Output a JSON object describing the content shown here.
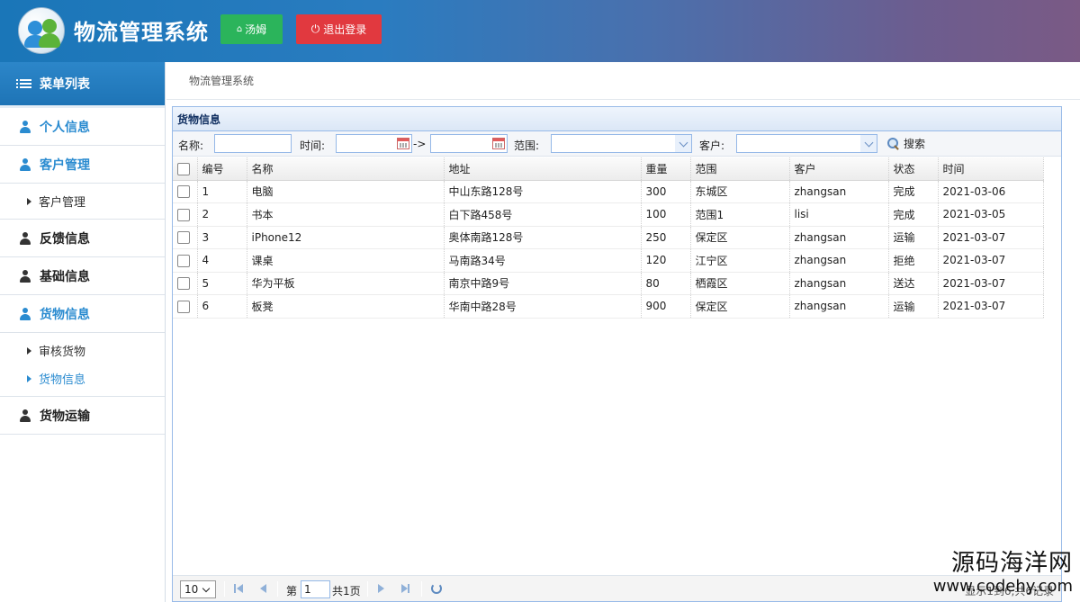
{
  "header": {
    "app_title": "物流管理系统",
    "user_button": "汤姆",
    "logout_button": "退出登录"
  },
  "sidebar": {
    "menu_title": "菜单列表",
    "items": {
      "personal": "个人信息",
      "customer": "客户管理",
      "customer_sub": "客户管理",
      "feedback": "反馈信息",
      "basic": "基础信息",
      "goods": "货物信息",
      "goods_sub_review": "审核货物",
      "goods_sub_info": "货物信息",
      "transport": "货物运输"
    }
  },
  "breadcrumb": "物流管理系统",
  "panel": {
    "title": "货物信息",
    "filters": {
      "name_label": "名称:",
      "time_label": "时间:",
      "arrow": "->",
      "range_label": "范围:",
      "customer_label": "客户:",
      "search_button": "搜索"
    },
    "columns": [
      "编号",
      "名称",
      "地址",
      "重量",
      "范围",
      "客户",
      "状态",
      "时间"
    ],
    "rows": [
      [
        "1",
        "电脑",
        "中山东路128号",
        "300",
        "东城区",
        "zhangsan",
        "完成",
        "2021-03-06"
      ],
      [
        "2",
        "书本",
        "白下路458号",
        "100",
        "范围1",
        "lisi",
        "完成",
        "2021-03-05"
      ],
      [
        "3",
        "iPhone12",
        "奥体南路128号",
        "250",
        "保定区",
        "zhangsan",
        "运输",
        "2021-03-07"
      ],
      [
        "4",
        "课桌",
        "马南路34号",
        "120",
        "江宁区",
        "zhangsan",
        "拒绝",
        "2021-03-07"
      ],
      [
        "5",
        "华为平板",
        "南京中路9号",
        "80",
        "栖霞区",
        "zhangsan",
        "送达",
        "2021-03-07"
      ],
      [
        "6",
        "板凳",
        "华南中路28号",
        "900",
        "保定区",
        "zhangsan",
        "运输",
        "2021-03-07"
      ]
    ],
    "pager": {
      "page_size": "10",
      "page_prefix": "第",
      "page_value": "1",
      "page_total": "共1页",
      "status": "显示1到6,共6记录"
    }
  },
  "watermark": {
    "line1": "源码海洋网",
    "line2": "www.codehy.com"
  }
}
